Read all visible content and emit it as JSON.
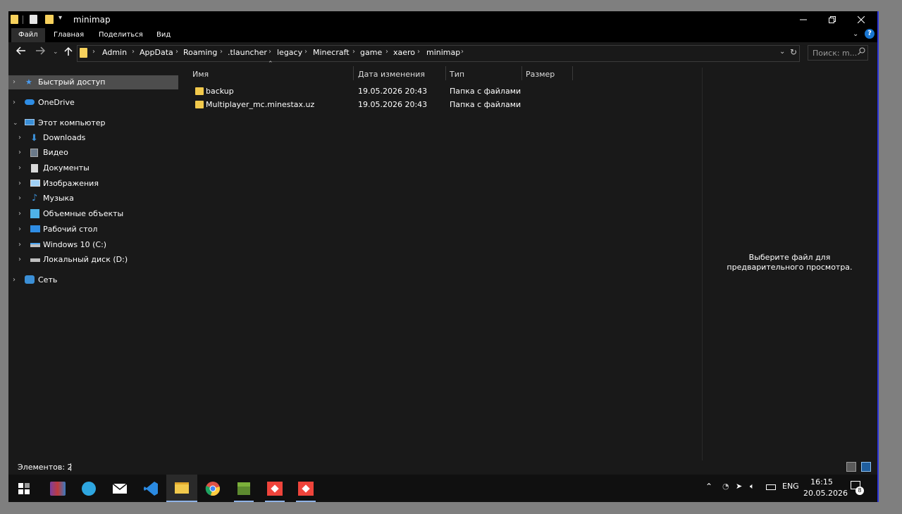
{
  "window": {
    "title": "minimap",
    "controls": [
      "minimize",
      "maximize",
      "close"
    ]
  },
  "ribbon": {
    "tabs": [
      "Файл",
      "Главная",
      "Поделиться",
      "Вид"
    ],
    "help_label": "?"
  },
  "address": {
    "breadcrumbs": [
      "Admin",
      "AppData",
      "Roaming",
      ".tlauncher",
      "legacy",
      "Minecraft",
      "game",
      "xaero",
      "minimap"
    ],
    "search_placeholder": "Поиск: m..."
  },
  "sidebar": {
    "items": [
      {
        "label": "Быстрый доступ",
        "icon": "star-icon",
        "selected": true
      },
      {
        "label": "OneDrive",
        "icon": "cloud-icon"
      },
      {
        "label": "Этот компьютер",
        "icon": "computer-icon",
        "expanded": true
      },
      {
        "label": "Downloads",
        "icon": "download-icon"
      },
      {
        "label": "Видео",
        "icon": "video-icon"
      },
      {
        "label": "Документы",
        "icon": "document-icon"
      },
      {
        "label": "Изображения",
        "icon": "picture-icon"
      },
      {
        "label": "Музыка",
        "icon": "music-icon"
      },
      {
        "label": "Объемные объекты",
        "icon": "cube-icon"
      },
      {
        "label": "Рабочий стол",
        "icon": "desktop-icon"
      },
      {
        "label": "Windows 10 (C:)",
        "icon": "drive-c-icon"
      },
      {
        "label": "Локальный диск (D:)",
        "icon": "drive-d-icon"
      },
      {
        "label": "Сеть",
        "icon": "network-icon"
      }
    ]
  },
  "files": {
    "columns": [
      "Имя",
      "Дата изменения",
      "Тип",
      "Размер"
    ],
    "rows": [
      {
        "name": "backup",
        "date": "19.05.2026 20:43",
        "type": "Папка с файлами",
        "size": ""
      },
      {
        "name": "Multiplayer_mc.minestax.uz",
        "date": "19.05.2026 20:43",
        "type": "Папка с файлами",
        "size": ""
      }
    ]
  },
  "preview": {
    "message": "Выберите файл для предварительного просмотра."
  },
  "status": {
    "items_count": "Элементов: 2"
  },
  "taskbar": {
    "apps": [
      "start-icon",
      "winrar-icon",
      "telegram-icon",
      "mail-icon",
      "vscode-icon",
      "file-explorer-icon",
      "chrome-icon",
      "minecraft-icon",
      "anydesk-icon",
      "anydesk-icon"
    ],
    "language": "ENG",
    "time": "16:15",
    "date": "20.05.2026",
    "notifications": "8"
  },
  "colors": {
    "background": "#191919",
    "titlebar": "#000000",
    "selected": "#4d4d4d",
    "folder": "#f2c94c",
    "accent": "#1976d2"
  }
}
